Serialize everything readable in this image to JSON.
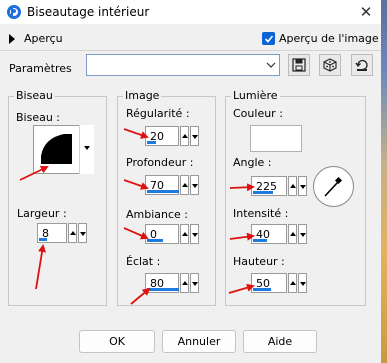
{
  "window": {
    "title": "Biseautage intérieur",
    "close_symbol": "✕"
  },
  "toolbar": {
    "apercu_label": "Aperçu",
    "apercu_image_label": "Aperçu de l'image",
    "apercu_image_checked": true,
    "params_label": "Paramètres",
    "params_value": ""
  },
  "groups": {
    "biseau": {
      "title": "Biseau",
      "shape_label": "Biseau :",
      "largeur_label": "Largeur :",
      "largeur_value": "8"
    },
    "image": {
      "title": "Image",
      "fields": [
        {
          "label": "Régularité :",
          "value": "20"
        },
        {
          "label": "Profondeur :",
          "value": "70"
        },
        {
          "label": "Ambiance :",
          "value": "0"
        },
        {
          "label": "Éclat :",
          "value": "80"
        }
      ]
    },
    "lumiere": {
      "title": "Lumière",
      "couleur_label": "Couleur :",
      "color_value": "#ffffff",
      "fields": [
        {
          "label": "Angle :",
          "value": "225"
        },
        {
          "label": "Intensité :",
          "value": "40"
        },
        {
          "label": "Hauteur :",
          "value": "50"
        }
      ]
    }
  },
  "buttons": {
    "ok": "OK",
    "annuler": "Annuler",
    "aide": "Aide"
  },
  "colors": {
    "accent": "#0a64d6",
    "annotation_arrow": "#e01010",
    "spin_bar": "#1f7ae0"
  }
}
